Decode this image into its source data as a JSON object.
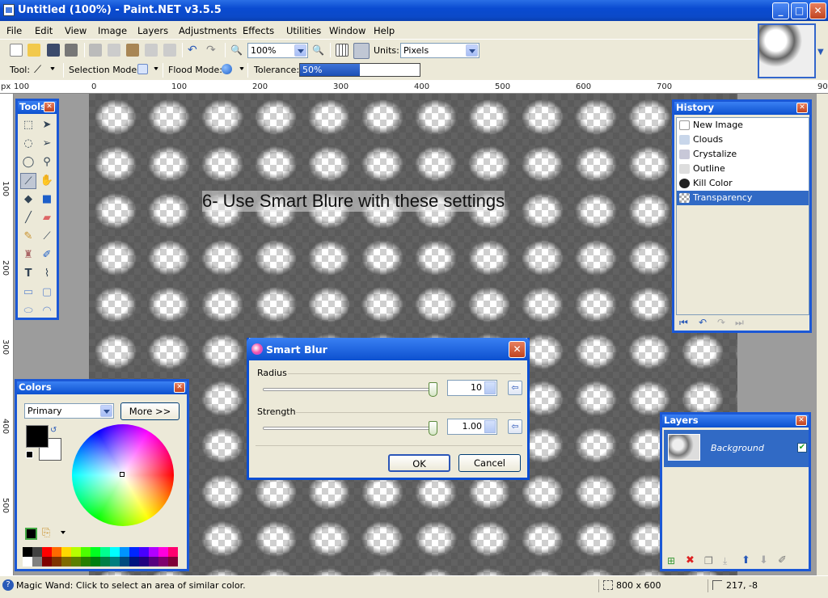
{
  "window": {
    "title": "Untitled (100%) - Paint.NET v3.5.5",
    "min_label": "_",
    "max_label": "□",
    "close_label": "✕"
  },
  "menu": [
    "File",
    "Edit",
    "View",
    "Image",
    "Layers",
    "Adjustments",
    "Effects",
    "Utilities",
    "Window",
    "Help"
  ],
  "toolbar": {
    "zoom_value": "100%",
    "units_label": "Units:",
    "units_value": "Pixels"
  },
  "toolbar2": {
    "tool_label": "Tool:",
    "selection_mode_label": "Selection Mode:",
    "flood_mode_label": "Flood Mode:",
    "tolerance_label": "Tolerance:",
    "tolerance_value": "50%",
    "tolerance_fraction": 0.5
  },
  "rulers": {
    "unit": "px",
    "h_ticks": [
      "100",
      "0",
      "100",
      "200",
      "300",
      "400",
      "500",
      "600",
      "700",
      "800",
      "90"
    ],
    "v_ticks": [
      "100",
      "200",
      "300",
      "400",
      "500"
    ]
  },
  "canvas": {
    "note": "6- Use Smart Blure with these settings"
  },
  "tools_panel": {
    "title": "Tools",
    "close": "✕"
  },
  "history_panel": {
    "title": "History",
    "close": "✕",
    "items": [
      "New Image",
      "Clouds",
      "Crystalize",
      "Outline",
      "Kill Color",
      "Transparency"
    ],
    "selected": "Transparency"
  },
  "dialog": {
    "title": "Smart Blur",
    "close": "✕",
    "radius_label": "Radius",
    "radius_value": "10",
    "strength_label": "Strength",
    "strength_value": "1.00",
    "ok": "OK",
    "cancel": "Cancel"
  },
  "colors_panel": {
    "title": "Colors",
    "close": "✕",
    "mode": "Primary",
    "more": "More >>"
  },
  "layers_panel": {
    "title": "Layers",
    "close": "✕",
    "layer_name": "Background",
    "layer_visible": true
  },
  "status": {
    "hint": "Magic Wand: Click to select an area of similar color.",
    "size": "800 x 600",
    "coords": "217, -8"
  },
  "colors": {
    "accent": "#0c50cf",
    "selection": "#316ac5",
    "panel_bg": "#ece9d8"
  }
}
